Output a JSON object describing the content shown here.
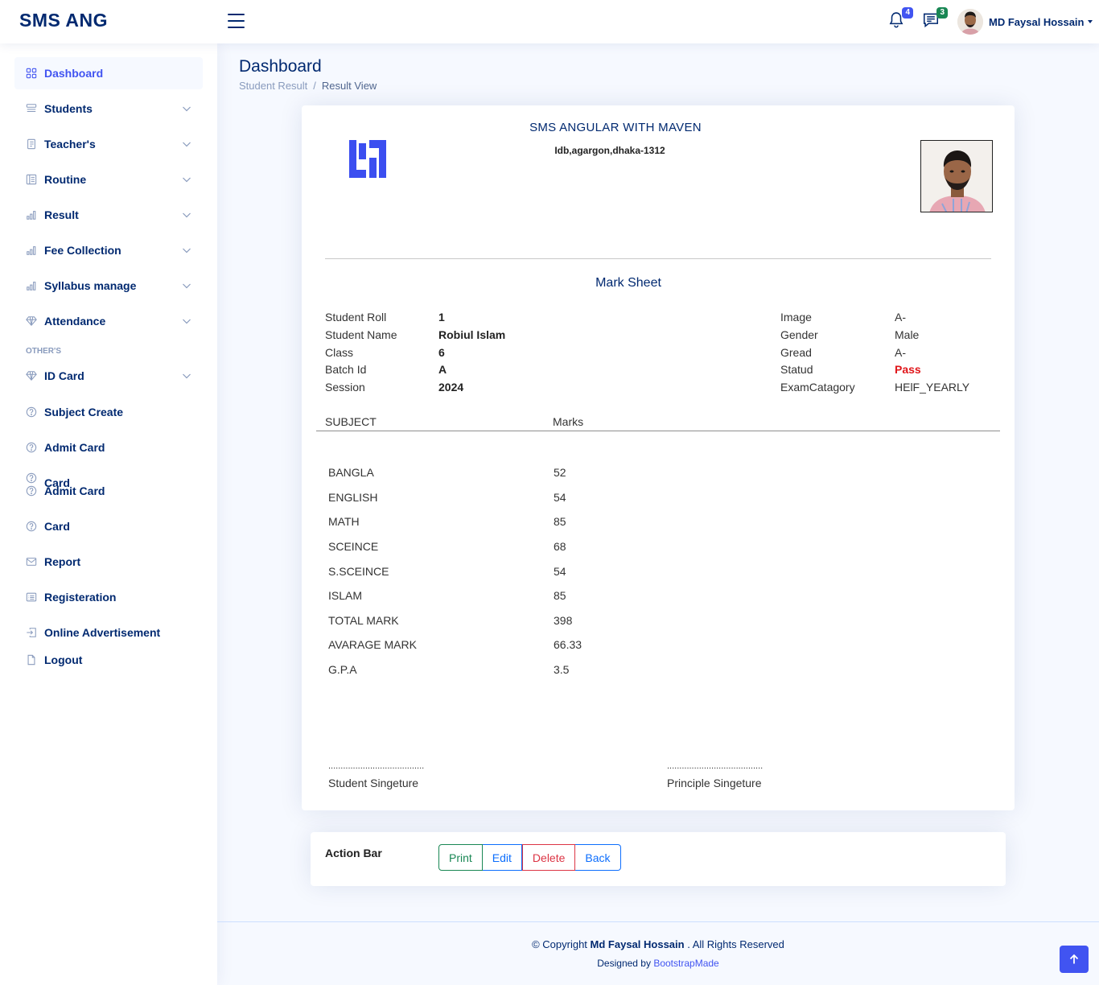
{
  "header": {
    "logo": "SMS ANG",
    "notifications_count": "4",
    "messages_count": "3",
    "profile_name": "MD Faysal Hossain"
  },
  "sidebar": {
    "items": [
      {
        "label": "Dashboard",
        "icon": "grid-icon"
      },
      {
        "label": "Students",
        "icon": "menu-button-icon"
      },
      {
        "label": "Teacher's",
        "icon": "journal-text-icon"
      },
      {
        "label": "Routine",
        "icon": "layout-text-icon"
      },
      {
        "label": "Result",
        "icon": "bar-chart-icon"
      },
      {
        "label": "Fee Collection",
        "icon": "bar-chart-icon"
      },
      {
        "label": "Syllabus manage",
        "icon": "bar-chart-icon"
      },
      {
        "label": "Attendance",
        "icon": "gem-icon"
      }
    ],
    "heading": "OTHER'S",
    "others": [
      {
        "label": "ID Card",
        "icon": "gem-icon"
      },
      {
        "label": "Subject Create",
        "icon": "question-circle-icon"
      },
      {
        "label": "Admit Card",
        "icon": "question-circle-icon"
      },
      {
        "label": "Admit Card",
        "icon": "question-circle-icon",
        "overlap_label": "Card"
      },
      {
        "label": "Card",
        "icon": "question-circle-icon"
      },
      {
        "label": "Report",
        "icon": "envelope-icon"
      },
      {
        "label": "Registeration",
        "icon": "card-list-icon"
      },
      {
        "label": "Online Advertisement",
        "icon": "box-arrow-in-right-icon"
      },
      {
        "label": "Logout",
        "icon": "file-icon"
      }
    ]
  },
  "page": {
    "title": "Dashboard",
    "breadcrumb": [
      "Student Result",
      "Result View"
    ]
  },
  "sheet": {
    "institute_name": "SMS ANGULAR WITH MAVEN",
    "institute_address": "Idb,agargon,dhaka-1312",
    "title": "Mark Sheet",
    "left_info": [
      {
        "label": "Student Roll",
        "value": "1"
      },
      {
        "label": "Student Name",
        "value": "Robiul Islam"
      },
      {
        "label": "Class",
        "value": "6"
      },
      {
        "label": "Batch Id",
        "value": "A"
      },
      {
        "label": "Session",
        "value": "2024"
      }
    ],
    "right_info": [
      {
        "label": "Image",
        "value": "A-"
      },
      {
        "label": "Gender",
        "value": "Male"
      },
      {
        "label": "Gread",
        "value": "A-"
      },
      {
        "label": "Statud",
        "value": "Pass"
      },
      {
        "label": "ExamCatagory",
        "value": "HElF_YEARLY"
      }
    ],
    "columns": [
      "SUBJECT",
      "Marks"
    ],
    "rows": [
      {
        "subject": "BANGLA",
        "marks": "52"
      },
      {
        "subject": "ENGLISH",
        "marks": "54"
      },
      {
        "subject": "MATH",
        "marks": "85"
      },
      {
        "subject": "SCEINCE",
        "marks": "68"
      },
      {
        "subject": "S.SCEINCE",
        "marks": "54"
      },
      {
        "subject": "ISLAM",
        "marks": "85"
      },
      {
        "subject": "TOTAL MARK",
        "marks": "398"
      },
      {
        "subject": "AVARAGE MARK",
        "marks": "66.33"
      },
      {
        "subject": "G.P.A",
        "marks": "3.5"
      }
    ],
    "signature_dots": ".......................................",
    "student_signature": "Student Singeture",
    "principal_signature": "Principle Singeture"
  },
  "action_bar": {
    "title": "Action Bar",
    "print": "Print",
    "edit": "Edit",
    "delete": "Delete",
    "back": "Back"
  },
  "footer": {
    "copyright_prefix": "© Copyright",
    "copyright_name": "Md Faysal Hossain",
    "copyright_suffix": ". All Rights Reserved",
    "designed_by": "Designed by",
    "designer": "BootstrapMade"
  },
  "colors": {
    "primary": "#4154f1",
    "navy": "#012970",
    "pass": "#e0161a",
    "success": "#198754",
    "danger": "#dc3545"
  }
}
